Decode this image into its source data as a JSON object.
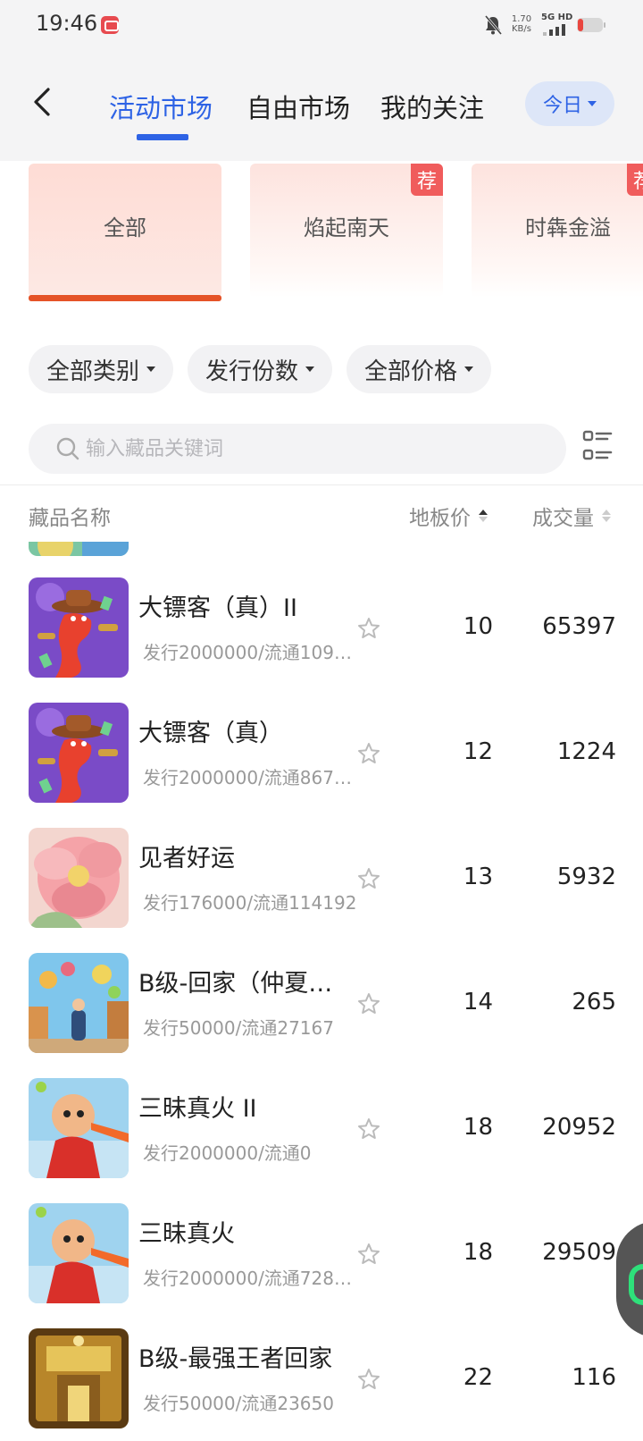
{
  "status_bar": {
    "time": "19:46",
    "net_speed_value": "1.70",
    "net_speed_unit": "KB/s",
    "signal_label": "5G HD"
  },
  "header": {
    "tabs": [
      {
        "label": "活动市场",
        "active": true
      },
      {
        "label": "自由市场"
      },
      {
        "label": "我的关注"
      }
    ],
    "date_filter": "今日",
    "accent_color": "#2e63e5"
  },
  "categories": [
    {
      "label": "全部",
      "active": true
    },
    {
      "label": "焰起南天",
      "badge": "荐"
    },
    {
      "label": "时犇金溢",
      "badge": "荐"
    }
  ],
  "filters": [
    {
      "label": "全部类别"
    },
    {
      "label": "发行份数"
    },
    {
      "label": "全部价格"
    }
  ],
  "search": {
    "placeholder": "输入藏品关键词"
  },
  "table": {
    "columns": {
      "name": "藏品名称",
      "price": "地板价",
      "volume": "成交量"
    },
    "rows": [
      {
        "name": "大镖客（真）II",
        "sub": "发行2000000/流通109…",
        "price": "10",
        "volume": "65397",
        "thumb": "cowboy-snake"
      },
      {
        "name": "大镖客（真）",
        "sub": "发行2000000/流通867…",
        "price": "12",
        "volume": "1224",
        "thumb": "cowboy-snake"
      },
      {
        "name": "见者好运",
        "sub": "发行176000/流通114192",
        "price": "13",
        "volume": "5932",
        "thumb": "flower"
      },
      {
        "name": "B级-回家（仲夏…",
        "sub": "发行50000/流通27167",
        "price": "14",
        "volume": "265",
        "thumb": "village"
      },
      {
        "name": "三昧真火 II",
        "sub": "发行2000000/流通0",
        "price": "18",
        "volume": "20952",
        "thumb": "boy"
      },
      {
        "name": "三昧真火",
        "sub": "发行2000000/流通728…",
        "price": "18",
        "volume": "29509",
        "thumb": "boy"
      },
      {
        "name": "B级-最强王者回家",
        "sub": "发行50000/流通23650",
        "price": "22",
        "volume": "116",
        "thumb": "gold"
      }
    ]
  }
}
